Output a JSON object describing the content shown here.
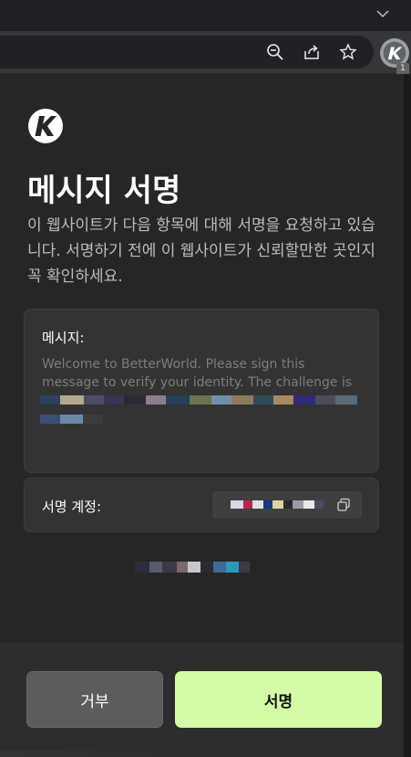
{
  "browser": {
    "icons": [
      "chevron-down-icon",
      "zoom-out-icon",
      "share-icon",
      "star-icon"
    ],
    "extension_badge": "1"
  },
  "popup": {
    "title": "메시지 서명",
    "description": "이 웹사이트가 다음 항목에 대해 서명을 요청하고 있습니다. 서명하기 전에 이 웹사이트가 신뢰할만한 곳인지 꼭 확인하세요.",
    "message_label": "메시지:",
    "message_text": "Welcome to BetterWorld. Please sign this message to verify your identity. The challenge is",
    "account_label": "서명 계정:",
    "buttons": {
      "reject": "거부",
      "sign": "서명"
    },
    "colors": {
      "background": "#262626",
      "card": "#333333",
      "sign_button": "#d4fca8",
      "reject_button": "#5c5c5c"
    }
  }
}
